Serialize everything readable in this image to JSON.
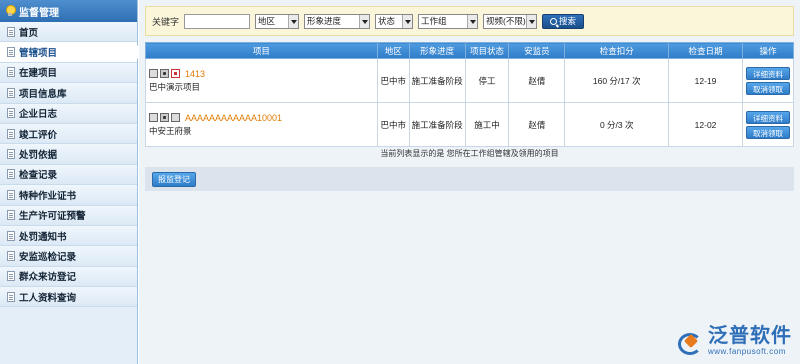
{
  "sidebar": {
    "title": "监督管理",
    "items": [
      {
        "label": "首页"
      },
      {
        "label": "管辖项目",
        "active": true
      },
      {
        "label": "在建项目"
      },
      {
        "label": "项目信息库"
      },
      {
        "label": "企业日志"
      },
      {
        "label": "竣工评价"
      },
      {
        "label": "处罚依据"
      },
      {
        "label": "检查记录"
      },
      {
        "label": "特种作业证书"
      },
      {
        "label": "生产许可证预警"
      },
      {
        "label": "处罚通知书"
      },
      {
        "label": "安监巡检记录"
      },
      {
        "label": "群众来访登记"
      },
      {
        "label": "工人资料查询"
      }
    ]
  },
  "filters": {
    "keyword_label": "关键字",
    "keyword_value": "",
    "region": "地区",
    "progress": "形象进度",
    "status": "状态",
    "work_group": "工作组",
    "video": "视频(不限)",
    "search_label": "搜索"
  },
  "table": {
    "headers": [
      "项目",
      "地区",
      "形象进度",
      "项目状态",
      "安监员",
      "检查扣分",
      "检查日期",
      "操作"
    ],
    "rows": [
      {
        "code": "1413",
        "name": "巴中演示项目",
        "region": "巴中市",
        "progress": "施工准备阶段",
        "status": "停工",
        "inspector": "赵倩",
        "deduction": "160 分/17 次",
        "date": "12-19",
        "btn_detail": "详细资料",
        "btn_cancel": "取消领取"
      },
      {
        "code": "AAAAAAAAAAAA10001",
        "name": "中安王府景",
        "region": "巴中市",
        "progress": "施工准备阶段",
        "status": "施工中",
        "inspector": "赵倩",
        "deduction": "0 分/3 次",
        "date": "12-02",
        "btn_detail": "详细资料",
        "btn_cancel": "取消领取"
      }
    ]
  },
  "notice": "当前列表显示的是 您所在工作组管辖及领用的项目",
  "actions": {
    "register_label": "报监登记"
  },
  "brand": {
    "name": "泛普软件",
    "url": "www.fanpusoft.com"
  }
}
